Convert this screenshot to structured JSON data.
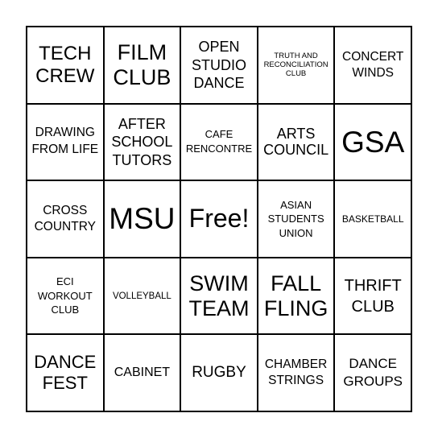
{
  "board": {
    "cells": [
      [
        "TECH CREW",
        "FILM CLUB",
        "OPEN STUDIO DANCE",
        "TRUTH AND RECONCILIATION CLUB",
        "CONCERT WINDS"
      ],
      [
        "DRAWING FROM LIFE",
        "AFTER SCHOOL TUTORS",
        "CAFE RENCONTRE",
        "ARTS COUNCIL",
        "GSA"
      ],
      [
        "CROSS COUNTRY",
        "MSU",
        "Free!",
        "ASIAN STUDENTS UNION",
        "BASKETBALL"
      ],
      [
        "ECI WORKOUT CLUB",
        "VOLLEYBALL",
        "SWIM TEAM",
        "FALL FLING",
        "THRIFT CLUB"
      ],
      [
        "DANCE FEST",
        "CABINET",
        "RUGBY",
        "CHAMBER STRINGS",
        "DANCE GROUPS"
      ]
    ]
  }
}
